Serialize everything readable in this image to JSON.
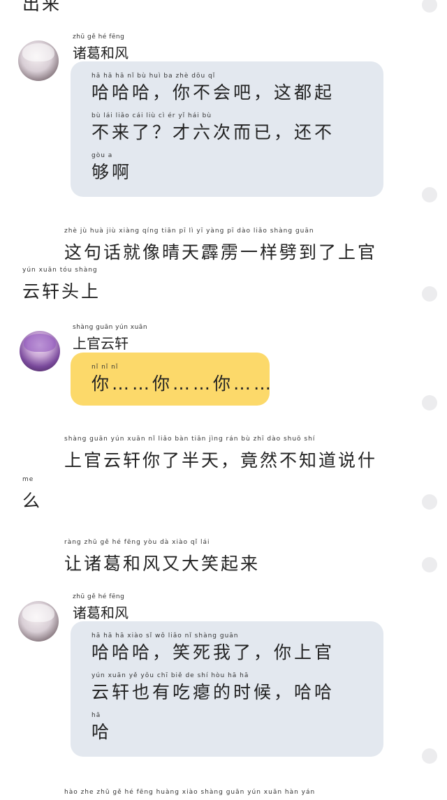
{
  "top_cut": {
    "text": "出来"
  },
  "bottom_cut": {
    "pinyin": "hào zhe zhū gě hé fēng huàng xiào shàng guān yún xuān hàn yán"
  },
  "speakers": {
    "zhuge": {
      "name": "诸葛和风",
      "pinyin": "zhū gě hé fēng"
    },
    "shangguan": {
      "name": "上官云轩",
      "pinyin": "shàng guān yún xuān"
    }
  },
  "messages": [
    {
      "speaker": "诸葛和风",
      "lines": [
        {
          "pinyin": "hā hā hā nǐ bù huì ba zhè dōu qǐ",
          "text": "哈哈哈，你不会吧，这都起"
        },
        {
          "pinyin": "bù lái liǎo cái liù cì ér yǐ hái bù",
          "text": "不来了？才六次而已，还不"
        },
        {
          "pinyin": "gòu a",
          "text": "够啊"
        }
      ]
    },
    {
      "speaker": "上官云轩",
      "lines": [
        {
          "pinyin": "nǐ nǐ nǐ",
          "text": "你……你……你……"
        }
      ]
    },
    {
      "speaker": "诸葛和风",
      "lines": [
        {
          "pinyin": "hā hā hā xiào sǐ wǒ liǎo nǐ shàng guān",
          "text": "哈哈哈，笑死我了，你上官"
        },
        {
          "pinyin": "yún xuān yě yǒu chī biě de shí hòu hā hā",
          "text": "云轩也有吃瘪的时候，哈哈"
        },
        {
          "pinyin": "hā",
          "text": "哈"
        }
      ]
    }
  ],
  "narration": [
    {
      "pinyin": "zhè jù huà jiù xiàng qíng tiān pī lì yī yàng pī dào liǎo shàng guān",
      "text": "这句话就像晴天霹雳一样劈到了上官"
    },
    {
      "pinyin": "yún xuān tóu shàng",
      "text": "云轩头上"
    },
    {
      "pinyin": "shàng guān yún xuān nǐ liǎo bàn tiān jìng rán bù zhī dào shuō shí",
      "text": "上官云轩你了半天，竟然不知道说什"
    },
    {
      "pinyin": "me",
      "text": "么"
    },
    {
      "pinyin": "ràng zhū gě hé fēng yòu dà xiào qǐ lái",
      "text": "让诸葛和风又大笑起来"
    }
  ]
}
